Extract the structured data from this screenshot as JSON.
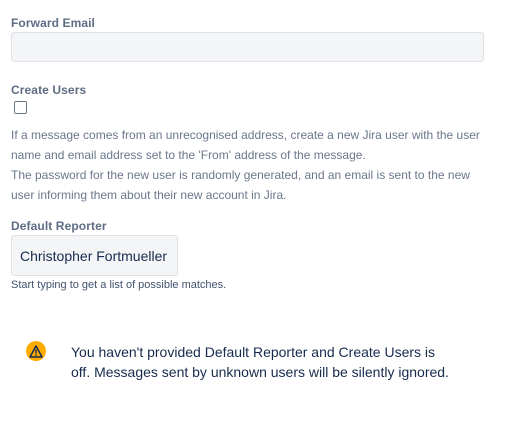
{
  "forward_email": {
    "label": "Forward Email",
    "value": ""
  },
  "create_users": {
    "label": "Create Users",
    "checked": false,
    "description_lines": [
      "If a message comes from an unrecognised address, create a new Jira user with the user",
      "name and email address set to the 'From' address of the message.",
      "The password for the new user is randomly generated, and an email is sent to the new",
      "user informing them about their new account in Jira."
    ]
  },
  "default_reporter": {
    "label": "Default Reporter",
    "value": "Christopher Fortmueller",
    "hint": "Start typing to get a list of possible matches."
  },
  "warning": {
    "icon": "warning-icon",
    "color": "#ffab00",
    "lines": [
      "You haven't provided Default Reporter and Create Users is",
      "off. Messages sent by unknown users will be silently ignored."
    ]
  }
}
